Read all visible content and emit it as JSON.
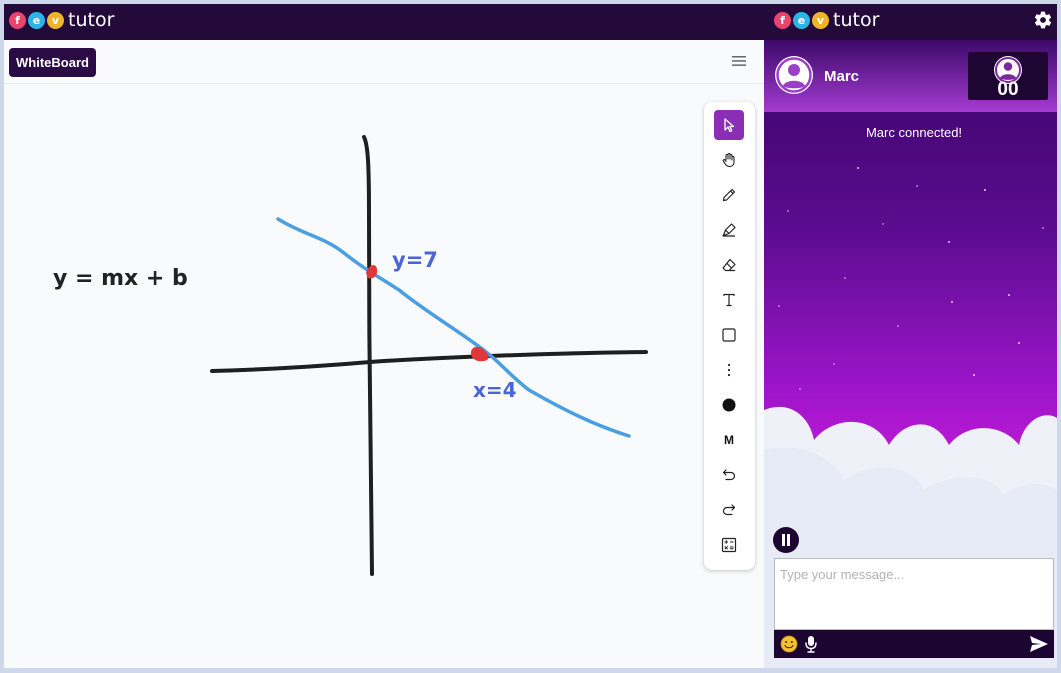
{
  "app": {
    "logo_letters": [
      "f",
      "e",
      "v"
    ],
    "logo_colors": [
      "#e8456d",
      "#2bb4e8",
      "#f0b429"
    ],
    "logo_word": "tutor"
  },
  "header": {
    "settings_icon": "gear-icon"
  },
  "whiteboard": {
    "tab_label": "WhiteBoard",
    "menu_icon": "hamburger-icon",
    "drawing": {
      "equation": "y = mx + b",
      "y_intercept_label": "y=7",
      "x_intercept_label": "x=4",
      "ink_colors": {
        "axes": "#1f1f1f",
        "line": "#4a9fe3",
        "labels": "#4a66d6",
        "points": "#e03838"
      }
    },
    "tools": [
      {
        "name": "select-tool",
        "icon": "cursor-arrow-icon",
        "active": true
      },
      {
        "name": "pan-tool",
        "icon": "hand-icon"
      },
      {
        "name": "pencil-tool",
        "icon": "pencil-icon"
      },
      {
        "name": "marker-tool",
        "icon": "marker-icon"
      },
      {
        "name": "eraser-tool",
        "icon": "eraser-icon"
      },
      {
        "name": "text-tool",
        "icon": "text-icon",
        "label": "T"
      },
      {
        "name": "rectangle-tool",
        "icon": "square-icon"
      },
      {
        "name": "more-tool",
        "icon": "vertical-dots-icon"
      },
      {
        "name": "color-tool",
        "icon": "filled-circle-icon"
      },
      {
        "name": "size-tool",
        "icon": "size-letter-icon",
        "label": "M"
      },
      {
        "name": "undo-tool",
        "icon": "undo-icon"
      },
      {
        "name": "redo-tool",
        "icon": "redo-icon"
      },
      {
        "name": "calculator-tool",
        "icon": "calculator-icon"
      }
    ],
    "accent_color": "#8a2fb5"
  },
  "chat": {
    "peer_name": "Marc",
    "counter_value": "00",
    "status_message": "Marc connected!",
    "message_placeholder": "Type your message...",
    "pause_icon": "pause-icon",
    "emoji_icon": "emoji-icon",
    "mic_icon": "microphone-icon",
    "send_icon": "send-icon"
  }
}
